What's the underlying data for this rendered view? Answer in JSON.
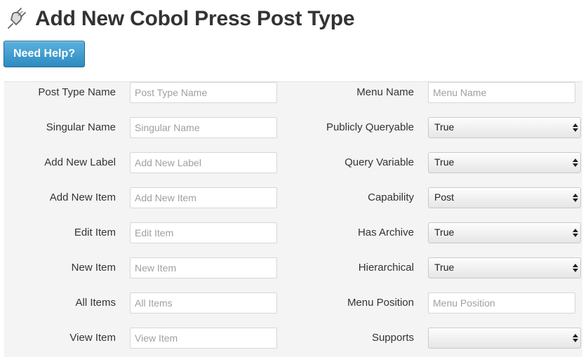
{
  "page": {
    "title": "Add New Cobol Press Post Type",
    "icon": "plugin-plug-icon",
    "help_button": "Need Help?"
  },
  "colors": {
    "help_button": "#2d8bc2",
    "panel_background": "#f4f4f4"
  },
  "rows": [
    {
      "left_label": "Post Type Name",
      "left_placeholder": "Post Type Name",
      "right_label": "Menu Name",
      "right_type": "text",
      "right_placeholder": "Menu Name",
      "right_value": ""
    },
    {
      "left_label": "Singular Name",
      "left_placeholder": "Singular Name",
      "right_label": "Publicly Queryable",
      "right_type": "select",
      "right_placeholder": "",
      "right_value": "True"
    },
    {
      "left_label": "Add New Label",
      "left_placeholder": "Add New Label",
      "right_label": "Query Variable",
      "right_type": "select",
      "right_placeholder": "",
      "right_value": "True"
    },
    {
      "left_label": "Add New Item",
      "left_placeholder": "Add New Item",
      "right_label": "Capability",
      "right_type": "select",
      "right_placeholder": "",
      "right_value": "Post"
    },
    {
      "left_label": "Edit Item",
      "left_placeholder": "Edit Item",
      "right_label": "Has Archive",
      "right_type": "select",
      "right_placeholder": "",
      "right_value": "True"
    },
    {
      "left_label": "New Item",
      "left_placeholder": "New Item",
      "right_label": "Hierarchical",
      "right_type": "select",
      "right_placeholder": "",
      "right_value": "True"
    },
    {
      "left_label": "All Items",
      "left_placeholder": "All Items",
      "right_label": "Menu Position",
      "right_type": "text",
      "right_placeholder": "Menu Position",
      "right_value": ""
    },
    {
      "left_label": "View Item",
      "left_placeholder": "View Item",
      "right_label": "Supports",
      "right_type": "select",
      "right_placeholder": "",
      "right_value": ""
    }
  ]
}
